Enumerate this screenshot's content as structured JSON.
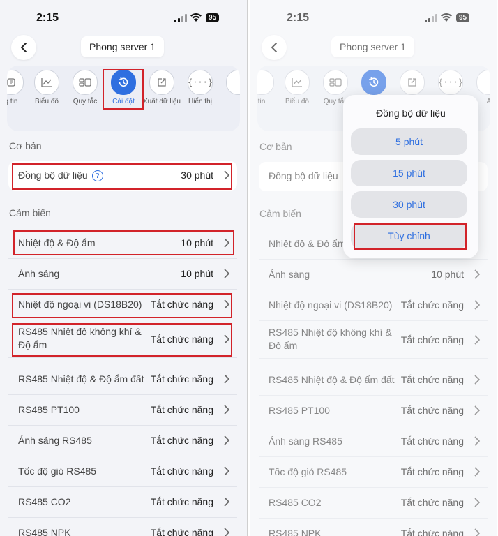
{
  "status": {
    "time": "2:15",
    "battery": "95"
  },
  "header": {
    "title": "Phong server 1"
  },
  "tabs": [
    {
      "label": "g tin",
      "icon": "info-icon"
    },
    {
      "label": "Biểu đồ",
      "icon": "chart-icon"
    },
    {
      "label": "Quy tắc",
      "icon": "rules-icon"
    },
    {
      "label": "Cài đặt",
      "icon": "settings-sync-icon"
    },
    {
      "label": "Xuất dữ liệu",
      "icon": "export-icon"
    },
    {
      "label": "Hiển thị",
      "icon": "braces-icon"
    }
  ],
  "right_tabs": {
    "info": "tin",
    "rules": "Quy tắc",
    "last": "A"
  },
  "sections": {
    "basic": "Cơ bản",
    "sensors": "Cảm biến"
  },
  "basic_row": {
    "label": "Đồng bộ dữ liệu",
    "value": "30 phút"
  },
  "sensor_rows": [
    {
      "label": "Nhiệt độ & Độ ẩm",
      "value": "10 phút"
    },
    {
      "label": "Ánh sáng",
      "value": "10 phút"
    },
    {
      "label": "Nhiệt độ ngoại vi (DS18B20)",
      "value": "Tắt chức năng"
    },
    {
      "label": "RS485 Nhiệt độ không khí & Độ ẩm",
      "value": "Tắt chức năng"
    },
    {
      "label": "RS485 Nhiệt độ & Độ ẩm đất",
      "value": "Tắt chức năng"
    },
    {
      "label": "RS485 PT100",
      "value": "Tắt chức năng"
    },
    {
      "label": "Ánh sáng RS485",
      "value": "Tắt chức năng"
    },
    {
      "label": "Tốc độ gió RS485",
      "value": "Tắt chức năng"
    },
    {
      "label": "RS485 CO2",
      "value": "Tắt chức năng"
    },
    {
      "label": "RS485 NPK",
      "value": "Tắt chức năng"
    }
  ],
  "popup": {
    "title": "Đồng bộ dữ liệu",
    "options": [
      "5 phút",
      "15 phút",
      "30 phút",
      "Tùy chỉnh"
    ]
  },
  "colors": {
    "accent": "#2f6fe0",
    "highlight": "#d2232a",
    "background": "#f3f4f8"
  }
}
